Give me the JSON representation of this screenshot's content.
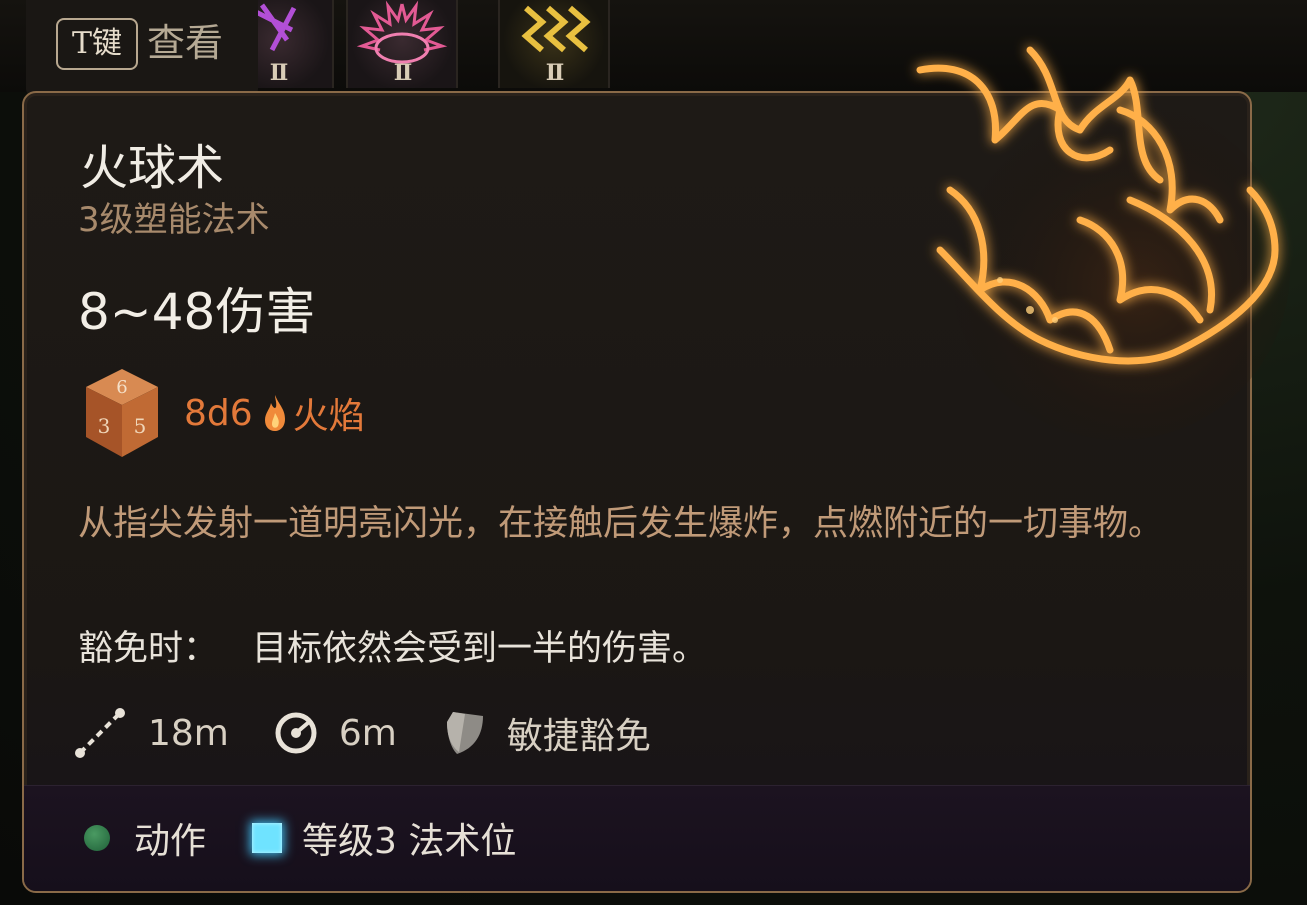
{
  "hotbar": {
    "slots": [
      {
        "icon": "purple-rune-icon",
        "rank": "II"
      },
      {
        "icon": "pink-thorn-burst-icon",
        "rank": "II"
      },
      {
        "icon": "lightning-chevron-icon",
        "rank": "II"
      }
    ]
  },
  "inspect_hint": {
    "key": "T键",
    "label": "查看"
  },
  "spell": {
    "name": "火球术",
    "school_level": "3级塑能法术",
    "damage_summary": "8~48伤害",
    "dice": "8d6",
    "damage_type": "火焰",
    "damage_type_color": "#e3793a",
    "description": "从指尖发射一道明亮闪光，在接触后发生爆炸，点燃附近的一切事物。",
    "save_label": "豁免时：",
    "save_effect": "目标依然会受到一半的伤害。",
    "range": "18m",
    "radius": "6m",
    "save_type": "敏捷豁免"
  },
  "footer": {
    "action_type": "动作",
    "action_color": "#2e7d4a",
    "slot_cost": "等级3 法术位",
    "slot_color": "#6fe3ff"
  },
  "icons": {
    "dice": "d6-dice-icon",
    "flame": "flame-icon",
    "range": "range-line-icon",
    "radius": "aoe-radius-icon",
    "save": "shield-icon",
    "art": "fireball-art-icon"
  }
}
